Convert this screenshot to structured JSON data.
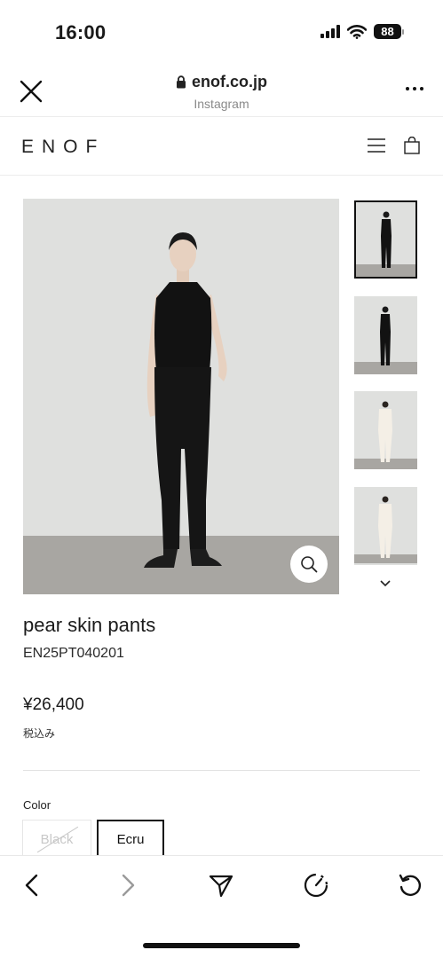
{
  "status_bar": {
    "time": "16:00",
    "battery": "88",
    "icons": [
      "signal-icon",
      "wifi-icon",
      "battery-icon"
    ]
  },
  "browser": {
    "url": "enof.co.jp",
    "source": "Instagram",
    "icons": [
      "close-icon",
      "lock-icon",
      "more-icon"
    ]
  },
  "site": {
    "logo": "ENOF",
    "icons": [
      "menu-icon",
      "bag-icon"
    ]
  },
  "gallery": {
    "main_image": "model in black sleeveless top and black pants on grey backdrop",
    "thumbnails": [
      {
        "desc": "front view black outfit",
        "active": true
      },
      {
        "desc": "back view black outfit",
        "active": false
      },
      {
        "desc": "front view ecru outfit",
        "active": false
      },
      {
        "desc": "back view ecru outfit",
        "active": false
      }
    ],
    "icons": [
      "zoom-icon",
      "chevron-down-icon"
    ]
  },
  "product": {
    "name": "pear skin pants",
    "code": "EN25PT040201",
    "price": "¥26,400",
    "tax_note": "税込み",
    "color_label": "Color",
    "colors": [
      {
        "label": "Black",
        "available": false,
        "selected": false
      },
      {
        "label": "Ecru",
        "available": true,
        "selected": true
      }
    ]
  },
  "toolbar": {
    "icons": [
      "back-icon",
      "forward-icon",
      "share-icon",
      "speed-icon",
      "reload-icon"
    ]
  },
  "colors": {
    "backdrop": "#dfe0de",
    "floor": "#a8a6a2",
    "garment": "#121212"
  }
}
